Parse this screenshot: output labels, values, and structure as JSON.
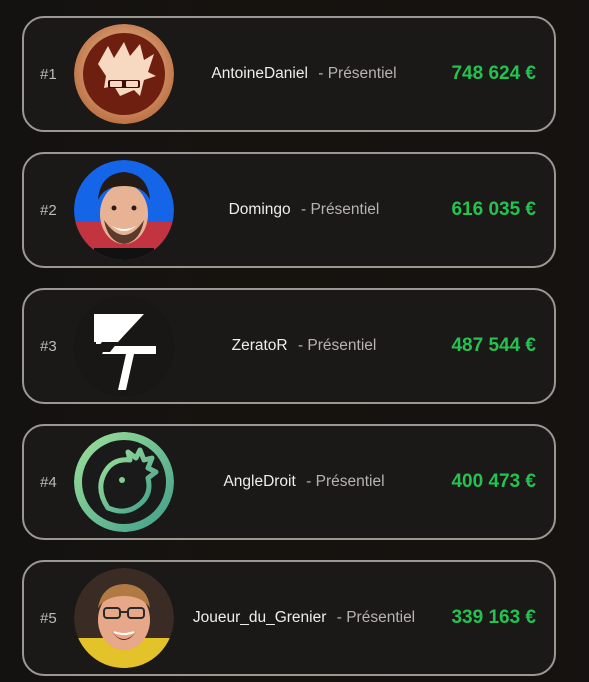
{
  "leaderboard": {
    "entries": [
      {
        "rank": "#1",
        "name": "AntoineDaniel",
        "separator": "-",
        "mode": "Présentiel",
        "amount": "748 624 €",
        "avatar": "antoinedaniel-avatar"
      },
      {
        "rank": "#2",
        "name": "Domingo",
        "separator": "-",
        "mode": "Présentiel",
        "amount": "616 035 €",
        "avatar": "domingo-avatar"
      },
      {
        "rank": "#3",
        "name": "ZeratoR",
        "separator": "-",
        "mode": "Présentiel",
        "amount": "487 544 €",
        "avatar": "zerator-avatar"
      },
      {
        "rank": "#4",
        "name": "AngleDroit",
        "separator": "-",
        "mode": "Présentiel",
        "amount": "400 473 €",
        "avatar": "angledroit-avatar"
      },
      {
        "rank": "#5",
        "name": "Joueur_du_Grenier",
        "separator": "-",
        "mode": "Présentiel",
        "amount": "339 163 €",
        "avatar": "joueur-du-grenier-avatar"
      }
    ]
  },
  "colors": {
    "amount": "#24c24f",
    "card_border": "#9b9894",
    "card_background": "#1b1918",
    "page_background": "#141211"
  }
}
